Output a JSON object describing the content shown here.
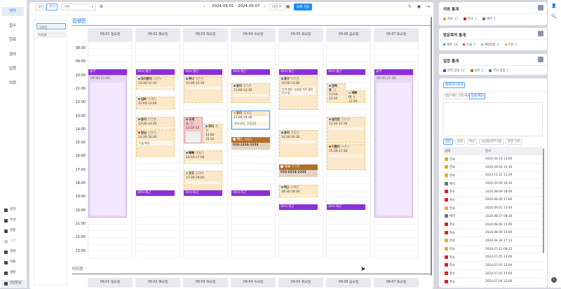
{
  "sidebar": {
    "top_items": [
      {
        "label": "예약",
        "active": true
      },
      {
        "label": "접수"
      },
      {
        "label": "진료"
      },
      {
        "label": "검사"
      },
      {
        "label": "입원"
      },
      {
        "label": "의뢰"
      }
    ],
    "bottom_items": [
      {
        "label": "문자"
      },
      {
        "label": "수납"
      },
      {
        "label": "일정"
      },
      {
        "label": "공병",
        "disabled": true
      },
      {
        "label": "전화"
      },
      {
        "label": "자료"
      },
      {
        "label": "설정"
      },
      {
        "label": "김양진님"
      }
    ]
  },
  "toolbar": {
    "day_label": "일간",
    "week_label": "주간",
    "view_select": "기본",
    "date_range": "2024.09.01 - 2024.09.07",
    "this_week": "이번 주",
    "pick_date": "날짜 지정"
  },
  "staff_list": [
    {
      "label": "김양진",
      "selected": true
    },
    {
      "label": "미지정"
    }
  ],
  "calendar": {
    "section_title": "김양진",
    "unassigned_title": "미지정",
    "hours": [
      "08:00",
      "09:00",
      "10:00",
      "11:00",
      "12:00",
      "13:00",
      "14:00",
      "15:00",
      "16:00",
      "17:00",
      "18:00",
      "19:00",
      "20:00",
      "21:00",
      "22:00",
      "23:00"
    ],
    "days": [
      {
        "label": "09.01 일요일",
        "off": {
          "label": "휴무",
          "time": "09:30-21:00",
          "start": 10,
          "end": 21
        },
        "events": []
      },
      {
        "label": "09.02 월요일",
        "events": [
          {
            "type": "bar",
            "label": "10시 출근",
            "start": 10
          },
          {
            "name": "조이풍이",
            "owner": "조현수",
            "time": "10:30-11:30",
            "start": 10.5,
            "end": 11.5,
            "dot": "#1e7be0"
          },
          {
            "name": "심바",
            "owner": "유혜진",
            "time": "12:00-13:00",
            "start": 12,
            "end": 13,
            "dot": "#1e7be0"
          },
          {
            "name": "둥이",
            "owner": "민은별",
            "time": "13:30-14:30",
            "start": 13.5,
            "end": 14.5,
            "dot": "#1e7be0"
          },
          {
            "name": "달님",
            "owner": "김현지",
            "time": "14:30-16:30",
            "start": 14.5,
            "end": 16.5,
            "dot": "#e02020",
            "memo": "수술 예약"
          },
          {
            "type": "bar",
            "label": "19시 퇴근",
            "start": 19
          }
        ]
      },
      {
        "label": "09.03 화요일",
        "events": [
          {
            "type": "bar",
            "label": "10시 출근",
            "start": 10
          },
          {
            "name": "루나",
            "owner": "김은주",
            "time": "10:30-12:30",
            "start": 10.5,
            "end": 12.5,
            "dot": "#1e7be0"
          },
          {
            "name": "크세스",
            "owner": "김",
            "time": "13:30-15",
            "start": 13.5,
            "end": 15.5,
            "dot": "#1e7be0",
            "style": "pink"
          },
          {
            "name": "까미",
            "owner": "최철",
            "time": "14:00-15:30",
            "start": 14,
            "end": 15.5,
            "dot": "#1e7be0"
          },
          {
            "name": "뻬뻬",
            "owner": "박홍식",
            "time": "16:00-17:00",
            "start": 16,
            "end": 17,
            "dot": "#1e7be0"
          },
          {
            "name": "코코",
            "owner": "김재석",
            "time": "17:30-19:00",
            "start": 17.5,
            "end": 19,
            "dot": "#5ab4f0"
          },
          {
            "type": "bar",
            "label": "19시 퇴근",
            "start": 19
          }
        ]
      },
      {
        "label": "09.04 수요일",
        "events": [
          {
            "type": "bar",
            "label": "10시 출근",
            "start": 10
          },
          {
            "name": "둥이",
            "owner": "임지아",
            "time": "11:00-12:30",
            "start": 11,
            "end": 12.5,
            "dot": "#1e7be0"
          },
          {
            "name": "초이",
            "owner": "최성희",
            "time": "13:00-14:30",
            "start": 13,
            "end": 14.5,
            "dot": "#f0a020",
            "memo": "치과 초진, 구강검사",
            "style": "sel"
          },
          {
            "name": "럭스",
            "owner": "서예지",
            "phone": "010-1234-1234",
            "start": 15,
            "end": 16,
            "style": "brown"
          },
          {
            "type": "bar",
            "label": "19시 퇴근",
            "start": 19
          }
        ]
      },
      {
        "label": "09.05 목요일",
        "events": [
          {
            "type": "bar",
            "label": "10시 출근",
            "start": 10
          },
          {
            "name": "몽구",
            "owner": "이수연",
            "time": "10:30-13:00",
            "start": 10.5,
            "end": 13,
            "dot": "#1e7be0",
            "memo": "안과 재진, 눈물을 자주 흘린다고 함"
          },
          {
            "name": "둥이",
            "owner": "방봉임",
            "time": "14:30-16:30",
            "start": 14.5,
            "end": 16.5,
            "dot": "#1e7be0"
          },
          {
            "name": "두부",
            "owner": "박기연",
            "phone": "010-6214-1234",
            "start": 17,
            "end": 18,
            "style": "brown"
          },
          {
            "name": "럭스",
            "owner": "서예지",
            "time": "18:30-19:30",
            "start": 18.5,
            "end": 19.5,
            "dot": "#1e7be0"
          },
          {
            "type": "bar",
            "label": "20시 퇴근",
            "start": 20
          }
        ]
      },
      {
        "label": "09.06 금요일",
        "events": [
          {
            "type": "bar",
            "label": "10시 출근",
            "start": 10
          },
          {
            "name": "엄복동",
            "owner": "엄.",
            "time": "11:00-12:30",
            "start": 11,
            "end": 12.5,
            "dot": "#1e7be0"
          },
          {
            "name": "세삐이",
            "owner": "조.",
            "time": "11:30-12:30",
            "start": 11.5,
            "end": 12.5,
            "dot": "#5ab4f0"
          },
          {
            "name": "살리만",
            "owner": "김수진",
            "time": "13:30-15:30",
            "start": 13.5,
            "end": 15.5,
            "dot": "#1e7be0"
          },
          {
            "name": "기쁨이",
            "owner": "조연수",
            "time": "15:30-17:30",
            "start": 15.5,
            "end": 17.5,
            "dot": "#e02020"
          },
          {
            "type": "bar",
            "label": "20시 퇴근",
            "start": 20
          }
        ]
      },
      {
        "label": "09.07 토요일",
        "off": {
          "label": "휴무",
          "time": "09:30-21:00",
          "start": 10,
          "end": 21
        },
        "events": []
      }
    ]
  },
  "stats": {
    "referral": {
      "title": "의뢰 통계",
      "items": [
        {
          "label": "완료",
          "count": "17",
          "color": "#f0a830"
        },
        {
          "label": "취소",
          "count": "1",
          "color": "#e02020"
        },
        {
          "label": "예약",
          "count": "1",
          "color": "#6b7480"
        }
      ]
    },
    "purpose": {
      "title": "방문목적 통계",
      "items": [
        {
          "label": "재진",
          "count": "14",
          "color": "#1e7be0"
        },
        {
          "label": "수술",
          "count": "2",
          "color": "#e02020"
        },
        {
          "label": "예방접종",
          "count": "2",
          "color": "#5ab4f0"
        },
        {
          "label": "초진",
          "count": "1",
          "color": "#f0a020"
        }
      ]
    },
    "schedule": {
      "title": "일정 통계",
      "items": [
        {
          "label": "반복 일정",
          "count": "12",
          "color": "#8c2fd8"
        },
        {
          "label": "리뷰",
          "count": "2",
          "color": "#b07028"
        },
        {
          "label": "부서 일정",
          "count": "2",
          "color": "#5a8a3a"
        }
      ]
    }
  },
  "history": {
    "top_button": "예약/히스토리",
    "memo_tabs": [
      {
        "label": "방문 메모"
      },
      {
        "label": "고객 메모"
      },
      {
        "label": "동물 메모",
        "active": true
      }
    ],
    "memo_value": "",
    "tabs": [
      {
        "label": "방문",
        "active": true
      },
      {
        "label": "진료"
      },
      {
        "label": "백신"
      },
      {
        "label": "사상충/외부구충"
      },
      {
        "label": "변경 기록"
      }
    ],
    "columns": [
      "상태",
      "일시"
    ],
    "rows": [
      {
        "status": "완료",
        "color": "#f0a830",
        "datetime": "2024.09.10 14:00"
      },
      {
        "status": "완료",
        "color": "#f0a830",
        "datetime": "2024.09.04 14:30"
      },
      {
        "status": "완료",
        "color": "#f0a830",
        "datetime": "2023.11.22 15:29"
      },
      {
        "status": "예약",
        "color": "#6b7480",
        "datetime": "2022.05.09 16:30"
      },
      {
        "status": "취소",
        "color": "#e02020",
        "datetime": "2024.08.09 18:00"
      },
      {
        "status": "취소",
        "color": "#e02020",
        "datetime": "2024.08.09 17:00"
      },
      {
        "status": "완료",
        "color": "#f0a830",
        "datetime": "2024.09.01 13:44"
      },
      {
        "status": "예약",
        "color": "#6b7480",
        "datetime": "2024.08.07 08:30"
      },
      {
        "status": "취소",
        "color": "#e02020",
        "datetime": "2024.08.06 15:00"
      },
      {
        "status": "취소",
        "color": "#e02020",
        "datetime": "2024.08.06 10:00"
      },
      {
        "status": "완료",
        "color": "#f0a830",
        "datetime": "2024.08.30 17:13"
      },
      {
        "status": "완료",
        "color": "#f0a830",
        "datetime": "2024.07.15 09:22"
      },
      {
        "status": "취소",
        "color": "#e02020",
        "datetime": "2024.07.05 14:00"
      },
      {
        "status": "취소",
        "color": "#e02020",
        "datetime": "2024.07.05 12:00"
      },
      {
        "status": "취소",
        "color": "#e02020",
        "datetime": "2024.07.05 11:00"
      },
      {
        "status": "취소",
        "color": "#e02020",
        "datetime": "2024.07.04 12:00"
      }
    ]
  }
}
